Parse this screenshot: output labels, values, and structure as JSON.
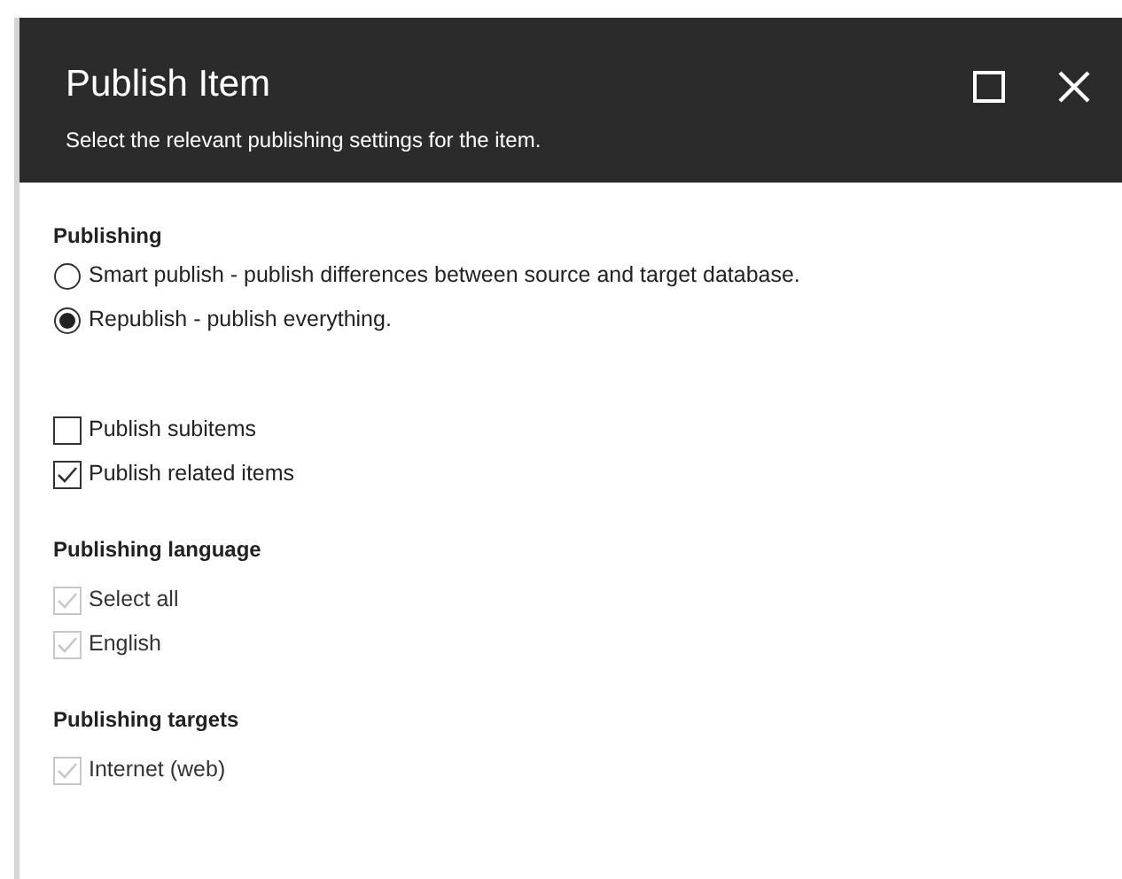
{
  "dialog": {
    "title": "Publish Item",
    "subtitle": "Select the relevant publishing settings for the item."
  },
  "sections": [
    {
      "heading": "Publishing",
      "options": [
        {
          "kind": "radio",
          "label": "Smart publish - publish differences between source and target database.",
          "selected": false,
          "disabled": false
        },
        {
          "kind": "radio",
          "label": "Republish - publish everything.",
          "selected": true,
          "disabled": false
        }
      ]
    },
    {
      "options": [
        {
          "kind": "checkbox",
          "label": "Publish subitems",
          "checked": false,
          "disabled": false
        },
        {
          "kind": "checkbox",
          "label": "Publish related items",
          "checked": true,
          "disabled": false
        }
      ]
    },
    {
      "heading": "Publishing language",
      "options": [
        {
          "kind": "checkbox",
          "label": "Select all",
          "checked": true,
          "disabled": true
        },
        {
          "kind": "checkbox",
          "label": "English",
          "checked": true,
          "disabled": true
        }
      ]
    },
    {
      "heading": "Publishing targets",
      "options": [
        {
          "kind": "checkbox",
          "label": "Internet (web)",
          "checked": true,
          "disabled": true
        }
      ]
    }
  ]
}
